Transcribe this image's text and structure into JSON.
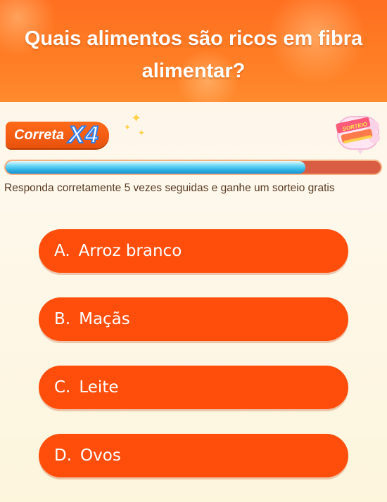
{
  "question": "Quais alimentos são ricos em fibra alimentar?",
  "streak": {
    "label": "Correta",
    "multiplier": "X4"
  },
  "prize": {
    "badge": "SORTEIO"
  },
  "progress": {
    "fraction": 0.8
  },
  "hint": "Responda corretamente 5 vezes seguidas e ganhe um sorteio gratis",
  "options": [
    {
      "letter": "A.",
      "text": "Arroz branco"
    },
    {
      "letter": "B.",
      "text": "Maçãs"
    },
    {
      "letter": "C.",
      "text": "Leite"
    },
    {
      "letter": "D.",
      "text": "Ovos"
    }
  ],
  "colors": {
    "header": "#ff7320",
    "option": "#ff4e0c",
    "progress_track": "#d85d43",
    "progress_fill": "#2fb3e4"
  },
  "icons": [
    "sparkle-icon",
    "lottery-ticket-icon"
  ]
}
